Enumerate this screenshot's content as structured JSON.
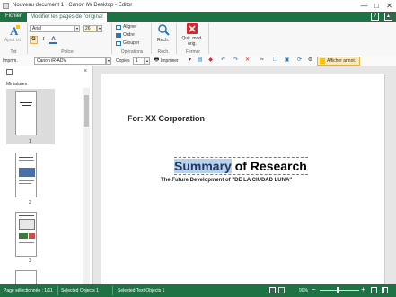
{
  "window": {
    "title": "Nouveau document 1 - Canon iW Desktop - Editor",
    "buttons": [
      "—",
      "□",
      "✕"
    ]
  },
  "tabs": [
    {
      "label": "Fichier",
      "active": false
    },
    {
      "label": "Modifier les pages de l'original",
      "active": true
    }
  ],
  "ribbon": {
    "text_group": {
      "label": "Txt",
      "add_text_label": "Ajout txt"
    },
    "font_group": {
      "label": "Police",
      "font_name": "Arial",
      "font_size": "26",
      "bold": "G",
      "italic": "I",
      "color": "A"
    },
    "operations_group": {
      "label": "Opérations",
      "align_label": "Aligner",
      "order_label": "Ordre",
      "group_label": "Grouper"
    },
    "search_group": {
      "label": "Rech.",
      "button_label": "Rech."
    },
    "close_group": {
      "label": "Fermer",
      "button_label": "Quit. mod. orig."
    }
  },
  "toolbar": {
    "printer_label": "Imprim.",
    "printer_value": "Canon iR-ADV",
    "copies_label": "Copies",
    "copies_value": "1",
    "print_button": "Imprimer",
    "show_annotations": "Afficher annot."
  },
  "sidebar": {
    "title": "Miniatures",
    "thumbnails": [
      {
        "number": "1"
      },
      {
        "number": "2"
      },
      {
        "number": "3"
      }
    ]
  },
  "page": {
    "for_line": "For: XX Corporation",
    "title_highlight": "Summary",
    "title_rest": " of Research",
    "subtitle": "The Future Development of \"DE LA CIUDAD LUNA\""
  },
  "status": {
    "page_selected": "Page sélectionnée : 1/11",
    "selected_objects": "Selected Objects 1",
    "selected_text_objects": "Selected Text Objects 1",
    "zoom": "90%"
  },
  "colors": {
    "accent": "#1f7244",
    "selection": "#b9d1ea",
    "close_red": "#d9262e"
  }
}
